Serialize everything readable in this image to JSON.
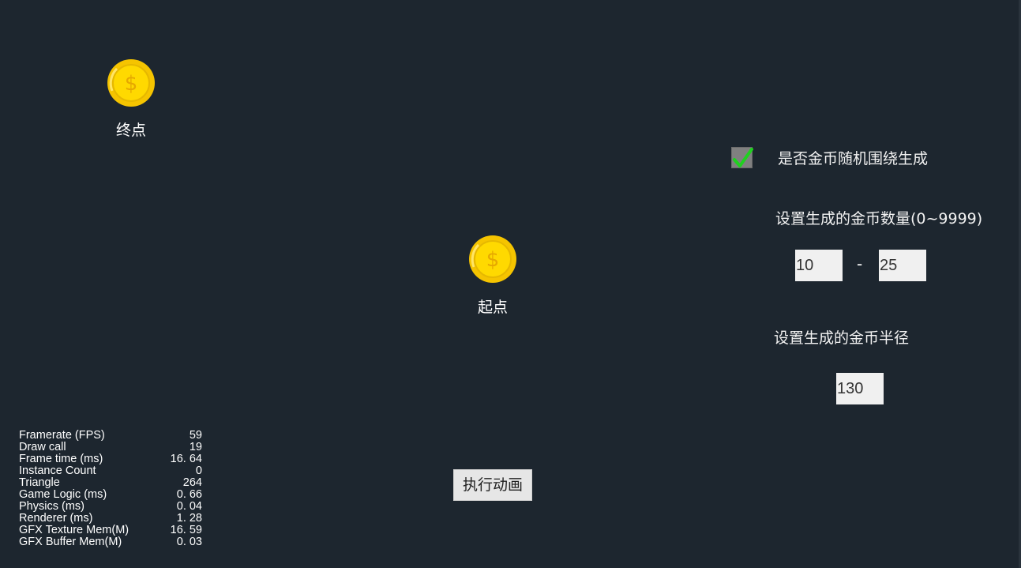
{
  "end_node": {
    "label": "终点",
    "icon": "dollar-coin-icon"
  },
  "start_node": {
    "label": "起点",
    "icon": "dollar-coin-icon"
  },
  "random_around": {
    "checked": true,
    "label": "是否金币随机围绕生成"
  },
  "count_setting": {
    "label": "设置生成的金币数量(0~9999)",
    "min": "10",
    "separator": "-",
    "max": "25"
  },
  "radius_setting": {
    "label": "设置生成的金币半径",
    "value": "130"
  },
  "action_button": {
    "label": "执行动画"
  },
  "stats": [
    {
      "name": "Framerate (FPS)",
      "value": "59"
    },
    {
      "name": "Draw call",
      "value": "19"
    },
    {
      "name": "Frame time (ms)",
      "value": "16. 64"
    },
    {
      "name": "Instance Count",
      "value": "0"
    },
    {
      "name": "Triangle",
      "value": "264"
    },
    {
      "name": "Game Logic (ms)",
      "value": "0. 66"
    },
    {
      "name": "Physics (ms)",
      "value": "0. 04"
    },
    {
      "name": "Renderer (ms)",
      "value": "1. 28"
    },
    {
      "name": "GFX Texture Mem(M)",
      "value": "16. 59"
    },
    {
      "name": "GFX Buffer Mem(M)",
      "value": "0. 03"
    }
  ],
  "colors": {
    "background": "#1d262f",
    "coin_gold": "#f5c400",
    "check_green": "#1fd11f"
  }
}
